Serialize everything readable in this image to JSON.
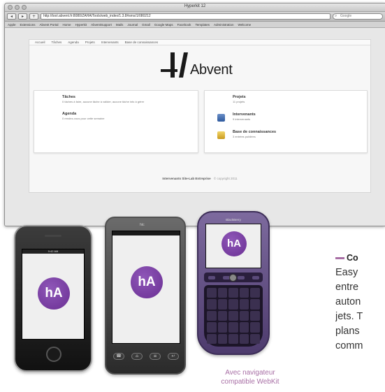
{
  "browser": {
    "window_title": "Hyperkit 12",
    "url": "http://tool.abvent.fr:8080/ZAHA/Tools/web_index/1.3.8#sms/1/080212",
    "search_placeholder": "Google",
    "bookmarks": [
      "Apple",
      "Extensions",
      "Abvent Portal",
      "Home",
      "Hyperkit",
      "AbventSupport",
      "Mails",
      "Journal",
      "Gmail",
      "Google Maps",
      "Facebook",
      "Templates",
      "Administration",
      "Welcome"
    ]
  },
  "page": {
    "nav": [
      "Accueil",
      "Tâches",
      "Agenda",
      "Projets",
      "Intervenants",
      "Base de connaissances"
    ],
    "logo_text": "Abvent",
    "left_box": [
      {
        "title": "Tâches",
        "desc": "0 tâches à faire, aucune tâche à valider, aucune tâche info à gérer"
      },
      {
        "title": "Agenda",
        "desc": "0 rendez-vous pour cette semaine"
      }
    ],
    "right_box": [
      {
        "title": "Projets",
        "desc": "11 projets"
      },
      {
        "title": "Intervenants",
        "desc": "9 intervenants"
      },
      {
        "title": "Base de connaissances",
        "desc": "3 entrées publiées"
      }
    ],
    "footer_bold": "Intervenants  Site-Lab  Entreprise",
    "footer_light": "© copyright 2011"
  },
  "phones": {
    "iphone_status": "9:42 AM",
    "htc_brand": "htc",
    "bb_brand": "BlackBerry",
    "logo_text": "hA"
  },
  "caption": {
    "line1": "Avec navigateur",
    "line2": "compatible WebKit"
  },
  "sidebar_text": {
    "heading": "Co",
    "lines": [
      "Easy",
      "entre",
      "auton",
      "jets. T",
      "plans",
      "comm"
    ]
  },
  "colors": {
    "accent_purple": "#a86fa5",
    "logo_purple": "#6a2f93"
  }
}
